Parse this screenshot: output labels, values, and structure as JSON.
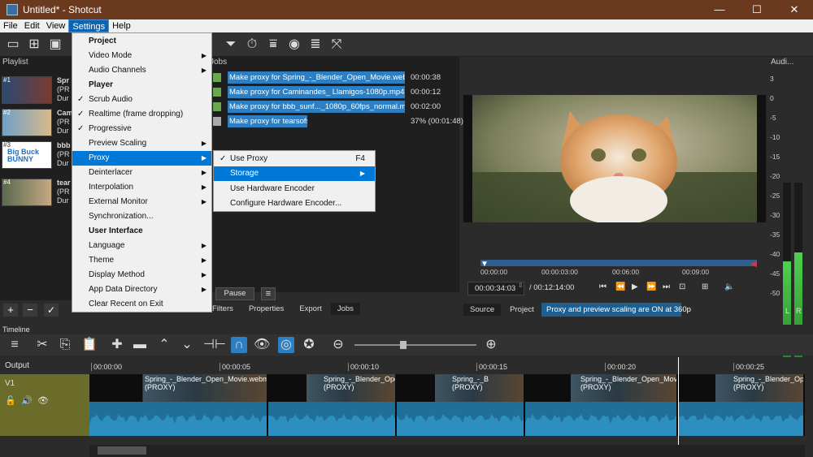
{
  "window": {
    "title": "Untitled* - Shotcut",
    "minimize": "—",
    "maximize": "☐",
    "close": "✕"
  },
  "menubar": [
    "File",
    "Edit",
    "View",
    "Settings",
    "Help"
  ],
  "playlist": {
    "title": "Playlist",
    "items": [
      {
        "num": "#1",
        "name": "Spr",
        "sub": "(PR",
        "dur": "Dur"
      },
      {
        "num": "#2",
        "name": "Cam",
        "sub": "(PR",
        "dur": "Dur"
      },
      {
        "num": "#3",
        "name": "bbb",
        "sub": "(PR",
        "dur": "Dur"
      },
      {
        "num": "#4",
        "name": "tear",
        "sub": "(PR",
        "dur": "Dur"
      }
    ],
    "buttons": [
      "+",
      "−",
      "✓"
    ]
  },
  "settings_menu": [
    {
      "label": "Project",
      "type": "header"
    },
    {
      "label": "Video Mode",
      "type": "sub"
    },
    {
      "label": "Audio Channels",
      "type": "sub"
    },
    {
      "label": "Player",
      "type": "header"
    },
    {
      "label": "Scrub Audio",
      "type": "check"
    },
    {
      "label": "Realtime (frame dropping)",
      "type": "check"
    },
    {
      "label": "Progressive",
      "type": "check"
    },
    {
      "label": "Preview Scaling",
      "type": "sub"
    },
    {
      "label": "Proxy",
      "type": "sub-selected"
    },
    {
      "label": "Deinterlacer",
      "type": "sub"
    },
    {
      "label": "Interpolation",
      "type": "sub"
    },
    {
      "label": "External Monitor",
      "type": "sub"
    },
    {
      "label": "Synchronization...",
      "type": "item"
    },
    {
      "label": "User Interface",
      "type": "header"
    },
    {
      "label": "Language",
      "type": "sub"
    },
    {
      "label": "Theme",
      "type": "sub"
    },
    {
      "label": "Display Method",
      "type": "sub"
    },
    {
      "label": "App Data Directory",
      "type": "sub"
    },
    {
      "label": "Clear Recent on Exit",
      "type": "item"
    }
  ],
  "proxy_menu": {
    "use_proxy": "Use Proxy",
    "use_proxy_shortcut": "F4",
    "storage": "Storage",
    "use_hw": "Use Hardware Encoder",
    "configure_hw": "Configure Hardware Encoder..."
  },
  "jobs": {
    "title": "Jobs",
    "rows": [
      {
        "label": "Make proxy for Spring_-_Blender_Open_Movie.webm",
        "status": "00:00:38"
      },
      {
        "label": "Make proxy for Caminandes_ Llamigos-1080p.mp4",
        "status": "00:00:12"
      },
      {
        "label": "Make proxy for bbb_sunf..._1080p_60fps_normal.mp4",
        "status": "00:02:00"
      },
      {
        "label": "Make proxy for tearsofsteel_4k.mov",
        "status": "37% (00:01:48)"
      }
    ],
    "pause": "Pause",
    "menu": "≡",
    "tabs": [
      "Filters",
      "Properties",
      "Export",
      "Jobs"
    ]
  },
  "player": {
    "ticks": [
      "00:00:00",
      "00:00:03:00",
      "00:06:00",
      "00:09:00"
    ],
    "position": "00:00:34:03",
    "duration": "/ 00:12:14:00",
    "tabs": [
      "Source",
      "Project"
    ],
    "status": "Proxy and preview scaling are ON at 360p"
  },
  "audio_meter": {
    "title": "Audi...",
    "scale": [
      "3",
      "0",
      "-5",
      "-10",
      "-15",
      "-20",
      "-25",
      "-30",
      "-35",
      "-40",
      "-45",
      "-50"
    ],
    "left": "L",
    "right": "R",
    "level_left": 0.55,
    "level_right": 0.6
  },
  "timeline": {
    "title": "Timeline",
    "output": "Output",
    "track": "V1",
    "ruler": [
      "00:00:00",
      "00:00:05",
      "00:00:10",
      "00:00:15",
      "00:00:20",
      "00:00:25"
    ],
    "clips": [
      {
        "name": "Spring_-_Blender_Open_Movie.webm",
        "proxy": "(PROXY)"
      },
      {
        "name": "Spring_-_Blender_Open",
        "proxy": "(PROXY)"
      },
      {
        "name": "Spring_-_B",
        "proxy": "(PROXY)"
      },
      {
        "name": "Spring_-_Blender_Open_Movie.",
        "proxy": "(PROXY)"
      },
      {
        "name": "Spring_-_Blender_Open",
        "proxy": "(PROXY)"
      }
    ]
  }
}
